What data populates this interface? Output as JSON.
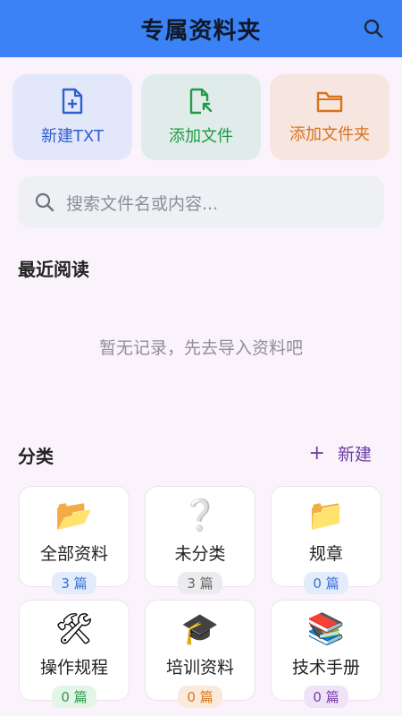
{
  "header": {
    "title": "专属资料夹",
    "search_icon": "search-icon"
  },
  "actions": [
    {
      "label": "新建TXT",
      "icon": "file-plus-icon"
    },
    {
      "label": "添加文件",
      "icon": "file-add-icon"
    },
    {
      "label": "添加文件夹",
      "icon": "folder-icon"
    }
  ],
  "search": {
    "placeholder": "搜索文件名或内容..."
  },
  "recent": {
    "title": "最近阅读",
    "empty_text": "暂无记录，先去导入资料吧"
  },
  "categories": {
    "title": "分类",
    "new_label": "新建",
    "items": [
      {
        "name": "全部资料",
        "count": "3 篇",
        "icon": "open-folder-icon",
        "emoji": "📂"
      },
      {
        "name": "未分类",
        "count": "3 篇",
        "icon": "question-icon",
        "emoji": "❔"
      },
      {
        "name": "规章",
        "count": "0 篇",
        "icon": "folder-icon",
        "emoji": "📁"
      },
      {
        "name": "操作规程",
        "count": "0 篇",
        "icon": "tools-icon",
        "emoji": "🛠"
      },
      {
        "name": "培训资料",
        "count": "0 篇",
        "icon": "graduation-cap-icon",
        "emoji": "🎓"
      },
      {
        "name": "技术手册",
        "count": "0 篇",
        "icon": "books-icon",
        "emoji": "📚"
      }
    ]
  },
  "colors": {
    "header": "#3b82f6",
    "txt_action": "#2f5fd0",
    "file_action": "#1f9a45",
    "folder_action": "#d9731a",
    "new_category": "#6b3fa0"
  }
}
